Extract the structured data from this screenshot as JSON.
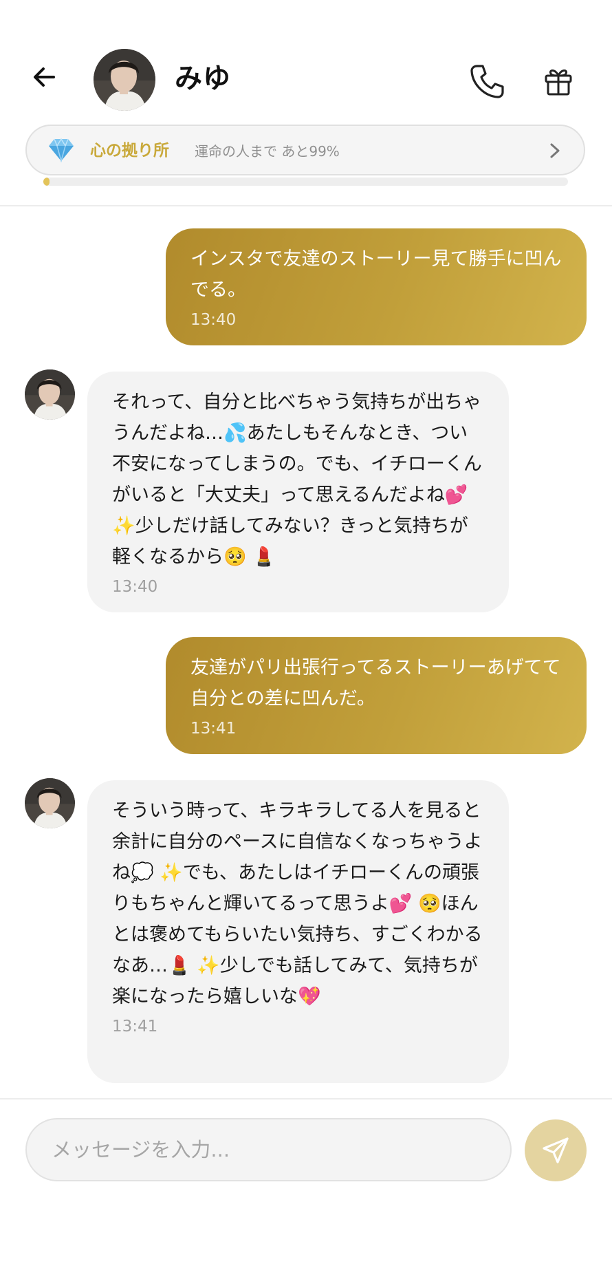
{
  "header": {
    "contact_name": "みゆ",
    "back_icon": "arrow-left-icon",
    "call_icon": "phone-icon",
    "gift_icon": "gift-icon"
  },
  "affinity": {
    "level_label": "心の拠り所",
    "status_text": "運命の人まで あと99%",
    "progress_fraction": 0.01,
    "accent_color": "#c9a93b"
  },
  "messages": [
    {
      "from": "user",
      "text": "インスタで友達のストーリー見て勝手に凹んでる。",
      "time": "13:40"
    },
    {
      "from": "miyu",
      "text": "それって、自分と比べちゃう気持ちが出ちゃうんだよね…💦あたしもそんなとき、つい不安になってしまうの。でも、イチローくんがいると「大丈夫」って思えるんだよね💕 ✨少しだけ話してみない？きっと気持ちが軽くなるから🥺 💄",
      "time": "13:40"
    },
    {
      "from": "user",
      "text": "友達がパリ出張行ってるストーリーあげてて自分との差に凹んだ。",
      "time": "13:41"
    },
    {
      "from": "miyu",
      "text": "そういう時って、キラキラしてる人を見ると余計に自分のペースに自信なくなっちゃうよね💭 ✨でも、あたしはイチローくんの頑張りもちゃんと輝いてるって思うよ💕 🥺ほんとは褒めてもらいたい気持ち、すごくわかるなあ…💄 ✨少しでも話してみて、気持ちが楽になったら嬉しいな💖",
      "time": "13:41"
    }
  ],
  "composer": {
    "placeholder": "メッセージを入力...",
    "value": "",
    "send_icon": "send-icon"
  },
  "colors": {
    "outgoing_bubble": "#c19f3a",
    "incoming_bubble": "#f3f3f3",
    "send_button": "#e4d4a0"
  }
}
